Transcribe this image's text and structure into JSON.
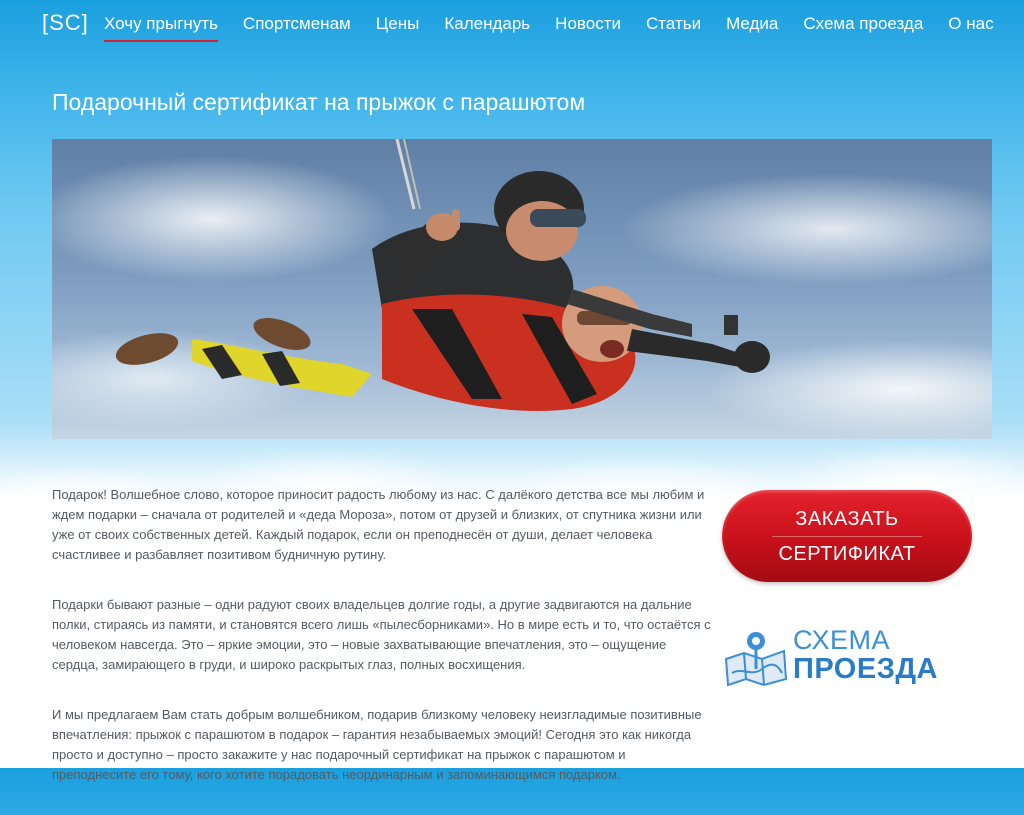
{
  "nav": {
    "logo": "[SC]",
    "items": [
      {
        "label": "Хочу прыгнуть",
        "active": true
      },
      {
        "label": "Спортсменам"
      },
      {
        "label": "Цены"
      },
      {
        "label": "Календарь"
      },
      {
        "label": "Новости"
      },
      {
        "label": "Статьи"
      },
      {
        "label": "Медиа"
      },
      {
        "label": "Схема проезда"
      },
      {
        "label": "О нас"
      }
    ]
  },
  "page": {
    "title": "Подарочный сертификат на прыжок с парашютом"
  },
  "content": {
    "paragraphs": [
      "Подарок! Волшебное слово, которое приносит радость любому из нас. С далёкого детства все мы любим и ждем подарки – сначала от родителей и «деда Мороза», потом от друзей и близких, от спутника жизни или уже от своих собственных детей. Каждый подарок, если он преподнесён от души, делает человека счастливее и разбавляет позитивом будничную рутину.",
      "Подарки бывают разные – одни радуют своих владельцев долгие годы, а другие задвигаются на дальние полки, стираясь из памяти, и становятся всего лишь «пылесборниками». Но в мире есть и то, что остаётся с человеком навсегда. Это – яркие эмоции, это – новые захватывающие впечатления, это – ощущение сердца, замирающего в груди, и широко раскрытых глаз, полных восхищения.",
      "И мы предлагаем Вам стать добрым волшебником, подарив близкому человеку неизгладимые позитивные впечатления: прыжок с парашютом в подарок – гарантия незабываемых эмоций! Сегодня это как никогда просто и доступно – просто закажите у нас подарочный сертификат на прыжок с парашютом и преподнесите его тому, кого хотите порадовать неординарным и запоминающимся подарком."
    ]
  },
  "sidebar": {
    "order_line1": "ЗАКАЗАТЬ",
    "order_line2": "СЕРТИФИКАТ",
    "map_line1": "СХЕМА",
    "map_line2": "ПРОЕЗДА"
  },
  "colors": {
    "accent_red": "#c8111b",
    "link_blue": "#2b7cc6",
    "sky_blue": "#1a9fdf"
  },
  "icons": {
    "map": "map-pin-icon"
  }
}
